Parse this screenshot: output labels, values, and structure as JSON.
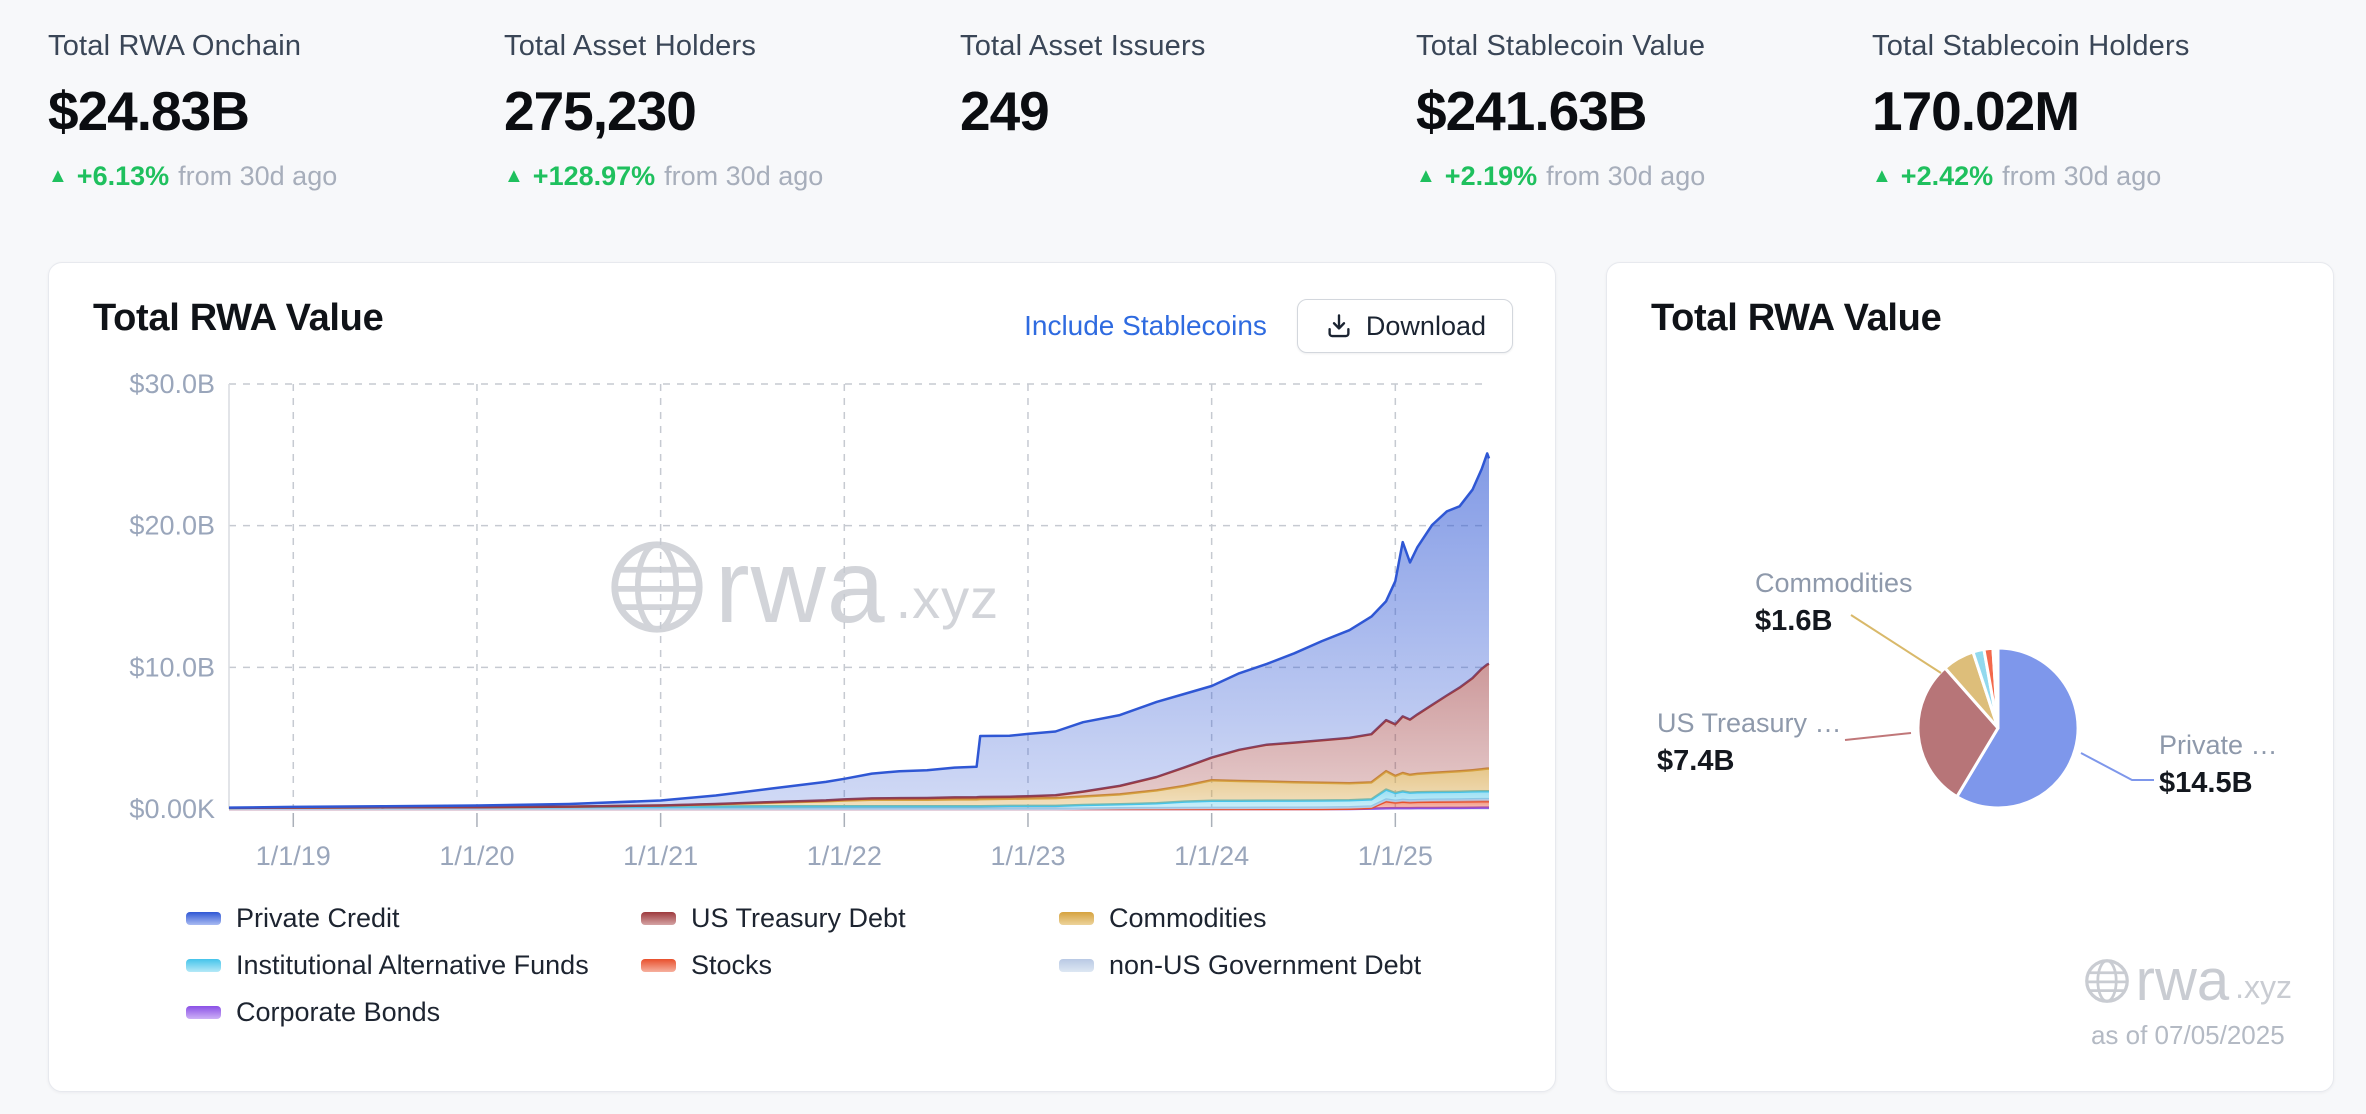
{
  "stats": [
    {
      "label": "Total RWA Onchain",
      "value": "$24.83B",
      "delta": "+6.13%",
      "delta_suffix": "from 30d ago"
    },
    {
      "label": "Total Asset Holders",
      "value": "275,230",
      "delta": "+128.97%",
      "delta_suffix": "from 30d ago"
    },
    {
      "label": "Total Asset Issuers",
      "value": "249",
      "delta": "",
      "delta_suffix": ""
    },
    {
      "label": "Total Stablecoin Value",
      "value": "$241.63B",
      "delta": "+2.19%",
      "delta_suffix": "from 30d ago"
    },
    {
      "label": "Total Stablecoin Holders",
      "value": "170.02M",
      "delta": "+2.42%",
      "delta_suffix": "from 30d ago"
    }
  ],
  "area_card": {
    "title": "Total RWA Value",
    "stablecoins_link": "Include Stablecoins",
    "download_label": "Download",
    "watermark_brand": "rwa",
    "watermark_tld": ".xyz"
  },
  "pie_card": {
    "title": "Total RWA Value",
    "watermark_brand": "rwa",
    "watermark_tld": ".xyz",
    "as_of": "as of 07/05/2025",
    "callouts": [
      {
        "name": "Commodities",
        "value": "$1.6B"
      },
      {
        "name": "US Treasury …",
        "value": "$7.4B"
      },
      {
        "name": "Private …",
        "value": "$14.5B"
      }
    ]
  },
  "colors": {
    "accent_link": "#2f6be0",
    "delta_green": "#1fc05e",
    "grid": "#c6cad1",
    "axis_label": "#9aa6bb",
    "watermark": "#d2d4d9"
  },
  "chart_data": [
    {
      "type": "area",
      "stacked": true,
      "title": "Total RWA Value",
      "unit": "$B",
      "xlim": [
        2018.65,
        2025.51
      ],
      "ylim": [
        0,
        30
      ],
      "grid": "dashed",
      "legend_position": "bottom",
      "x_ticks": [
        {
          "year": 2019,
          "label": "1/1/19"
        },
        {
          "year": 2020,
          "label": "1/1/20"
        },
        {
          "year": 2021,
          "label": "1/1/21"
        },
        {
          "year": 2022,
          "label": "1/1/22"
        },
        {
          "year": 2023,
          "label": "1/1/23"
        },
        {
          "year": 2024,
          "label": "1/1/24"
        },
        {
          "year": 2025,
          "label": "1/1/25"
        }
      ],
      "y_ticks": [
        {
          "v": 0,
          "label": "$0.00K"
        },
        {
          "v": 10,
          "label": "$10.0B"
        },
        {
          "v": 20,
          "label": "$20.0B"
        },
        {
          "v": 30,
          "label": "$30.0B"
        }
      ],
      "x": [
        2018.65,
        2019.0,
        2019.5,
        2020.0,
        2020.5,
        2021.0,
        2021.3,
        2021.6,
        2021.9,
        2022.0,
        2022.15,
        2022.3,
        2022.45,
        2022.6,
        2022.72,
        2022.74,
        2022.9,
        2023.0,
        2023.15,
        2023.3,
        2023.5,
        2023.7,
        2023.85,
        2024.0,
        2024.15,
        2024.3,
        2024.45,
        2024.6,
        2024.75,
        2024.87,
        2024.95,
        2025.0,
        2025.04,
        2025.08,
        2025.12,
        2025.2,
        2025.28,
        2025.35,
        2025.42,
        2025.47,
        2025.5,
        2025.51
      ],
      "series": [
        {
          "name": "Corporate Bonds",
          "color": "#8a50e6",
          "color_light": "#cdb1f6",
          "fill_top_opacity": 0.7,
          "fill_bottom_opacity": 0.3,
          "values": [
            0,
            0,
            0,
            0,
            0,
            0,
            0,
            0,
            0,
            0,
            0,
            0,
            0,
            0,
            0,
            0,
            0,
            0,
            0,
            0,
            0,
            0,
            0,
            0,
            0,
            0,
            0,
            0,
            0,
            0.03,
            0.05,
            0.06,
            0.06,
            0.06,
            0.07,
            0.07,
            0.08,
            0.08,
            0.09,
            0.1,
            0.1,
            0.1
          ]
        },
        {
          "name": "Stocks",
          "color": "#e8502c",
          "color_light": "#f6b09e",
          "fill_top_opacity": 0.6,
          "fill_bottom_opacity": 0.3,
          "values": [
            0,
            0,
            0,
            0,
            0,
            0,
            0,
            0,
            0,
            0,
            0,
            0,
            0,
            0,
            0,
            0,
            0,
            0,
            0,
            0,
            0,
            0,
            0,
            0,
            0,
            0,
            0,
            0,
            0.02,
            0.05,
            0.5,
            0.4,
            0.45,
            0.42,
            0.43,
            0.44,
            0.44,
            0.45,
            0.45,
            0.45,
            0.45,
            0.45
          ]
        },
        {
          "name": "non-US Government Debt",
          "color": "#b9c9e4",
          "color_light": "#dde7f3",
          "fill_top_opacity": 0.6,
          "fill_bottom_opacity": 0.3,
          "values": [
            0,
            0,
            0,
            0,
            0,
            0,
            0,
            0,
            0,
            0,
            0,
            0,
            0,
            0,
            0,
            0,
            0,
            0,
            0,
            0.03,
            0.05,
            0.06,
            0.07,
            0.08,
            0.08,
            0.09,
            0.09,
            0.1,
            0.1,
            0.1,
            0.12,
            0.12,
            0.13,
            0.13,
            0.13,
            0.14,
            0.14,
            0.14,
            0.15,
            0.15,
            0.15,
            0.15
          ]
        },
        {
          "name": "Institutional Alternative Funds",
          "color": "#45c4ea",
          "color_light": "#b5e9f7",
          "fill_top_opacity": 0.55,
          "fill_bottom_opacity": 0.25,
          "values": [
            0.08,
            0.1,
            0.12,
            0.13,
            0.15,
            0.17,
            0.18,
            0.2,
            0.2,
            0.2,
            0.2,
            0.2,
            0.2,
            0.2,
            0.2,
            0.2,
            0.22,
            0.22,
            0.22,
            0.25,
            0.28,
            0.35,
            0.45,
            0.5,
            0.5,
            0.5,
            0.5,
            0.5,
            0.5,
            0.5,
            0.7,
            0.55,
            0.6,
            0.55,
            0.55,
            0.55,
            0.55,
            0.55,
            0.55,
            0.55,
            0.55,
            0.55
          ]
        },
        {
          "name": "Commodities",
          "color": "#d6a23e",
          "color_light": "#ecd39b",
          "fill_top_opacity": 0.6,
          "fill_bottom_opacity": 0.32,
          "values": [
            0,
            0,
            0,
            0,
            0.02,
            0.08,
            0.15,
            0.25,
            0.35,
            0.4,
            0.45,
            0.45,
            0.45,
            0.48,
            0.48,
            0.5,
            0.5,
            0.52,
            0.55,
            0.6,
            0.7,
            0.9,
            1.1,
            1.45,
            1.4,
            1.35,
            1.3,
            1.25,
            1.2,
            1.2,
            1.3,
            1.2,
            1.3,
            1.25,
            1.3,
            1.35,
            1.4,
            1.45,
            1.5,
            1.55,
            1.6,
            1.6
          ]
        },
        {
          "name": "US Treasury Debt",
          "color": "#9e3a3d",
          "color_light": "#d4a3a4",
          "fill_top_opacity": 0.52,
          "fill_bottom_opacity": 0.25,
          "values": [
            0,
            0,
            0,
            0,
            0,
            0,
            0.02,
            0.04,
            0.06,
            0.08,
            0.1,
            0.12,
            0.13,
            0.14,
            0.15,
            0.15,
            0.15,
            0.16,
            0.2,
            0.35,
            0.6,
            0.95,
            1.3,
            1.6,
            2.2,
            2.6,
            2.8,
            3.0,
            3.2,
            3.4,
            3.6,
            3.65,
            4.0,
            3.9,
            4.2,
            4.8,
            5.4,
            5.9,
            6.5,
            7.1,
            7.35,
            7.4
          ]
        },
        {
          "name": "Private Credit",
          "color": "#2f57d4",
          "color_light": "#a9bbf2",
          "fill_top_opacity": 0.6,
          "fill_bottom_opacity": 0.22,
          "values": [
            0.02,
            0.05,
            0.08,
            0.12,
            0.18,
            0.35,
            0.6,
            0.95,
            1.3,
            1.45,
            1.75,
            1.9,
            1.95,
            2.1,
            2.15,
            4.3,
            4.3,
            4.4,
            4.5,
            4.9,
            5.0,
            5.3,
            5.2,
            5.05,
            5.4,
            5.7,
            6.3,
            7.0,
            7.6,
            8.3,
            8.4,
            10.1,
            12.3,
            11.1,
            11.8,
            12.7,
            13.0,
            12.8,
            13.3,
            14.1,
            14.9,
            14.5
          ]
        }
      ],
      "legend_order": [
        "Private Credit",
        "US Treasury Debt",
        "Commodities",
        "Institutional Alternative Funds",
        "Stocks",
        "non-US Government Debt",
        "Corporate Bonds"
      ]
    },
    {
      "type": "pie",
      "title": "Total RWA Value",
      "unit": "$B",
      "as_of": "07/05/2025",
      "start_angle_deg": 0,
      "clockwise": true,
      "slices": [
        {
          "name": "Private Credit",
          "value": 14.5,
          "color": "#7e97eb"
        },
        {
          "name": "US Treasury Debt",
          "value": 7.4,
          "color": "#b77578"
        },
        {
          "name": "Commodities",
          "value": 1.6,
          "color": "#ddbe7a"
        },
        {
          "name": "Institutional Alternative Funds",
          "value": 0.55,
          "color": "#92d9ee"
        },
        {
          "name": "Stocks",
          "value": 0.45,
          "color": "#f3694c"
        },
        {
          "name": "non-US Government Debt",
          "value": 0.15,
          "color": "#aab9dc"
        },
        {
          "name": "Corporate Bonds",
          "value": 0.1,
          "color": "#a07af0"
        }
      ]
    }
  ]
}
